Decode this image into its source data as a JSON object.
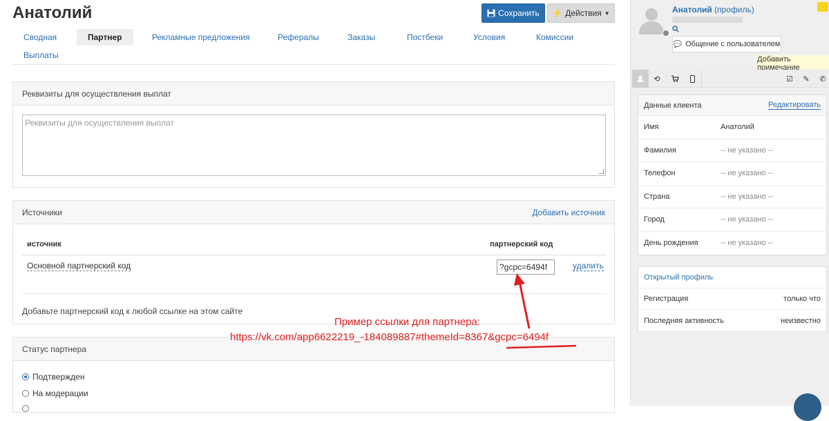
{
  "header": {
    "title": "Анатолий",
    "save_label": "Сохранить",
    "actions_label": "Действия"
  },
  "tabs": [
    {
      "label": "Сводная"
    },
    {
      "label": "Партнер"
    },
    {
      "label": "Рекламные предложения"
    },
    {
      "label": "Рефералы"
    },
    {
      "label": "Заказы"
    },
    {
      "label": "Постбеки"
    },
    {
      "label": "Условия"
    },
    {
      "label": "Комиссии"
    },
    {
      "label": "Выплаты"
    }
  ],
  "requisites": {
    "title": "Реквизиты для осуществления выплат",
    "placeholder": "Реквизиты для осуществления выплат"
  },
  "sources": {
    "title": "Источники",
    "add_label": "Добавить источник",
    "col_source": "источник",
    "col_code": "партнерский код",
    "rows": [
      {
        "name": "Основной партнерский код",
        "code": "?gcpc=6494f",
        "delete_label": "удалить"
      }
    ],
    "hint": "Добавьте партнерский код к любой ссылке на этом сайте"
  },
  "partner_status": {
    "title": "Статус партнера",
    "options": [
      {
        "label": "Подтвержден",
        "selected": true
      },
      {
        "label": "На модерации",
        "selected": false
      }
    ]
  },
  "annotation": {
    "line1": "Пример ссылки для партнера:",
    "line2": "https://vk.com/app6622219_-184089887#themeId=8367&gcpc=6494f",
    "color": "#e02020"
  },
  "sidebar": {
    "user_name": "Анатолий",
    "profile_label": "(профиль)",
    "chat_label": "Общение с пользователем",
    "add_note_label": "Добавить примечание",
    "client_card": {
      "title": "Данные клиента",
      "edit_label": "Редактировать",
      "rows": [
        {
          "label": "Имя",
          "value": "Анатолий"
        },
        {
          "label": "Фамилия",
          "value": "-- не указано --"
        },
        {
          "label": "Телефон",
          "value": "-- не указано --"
        },
        {
          "label": "Страна",
          "value": "-- не указано --"
        },
        {
          "label": "Город",
          "value": "-- не указано --"
        },
        {
          "label": "День рождения",
          "value": "-- не указано --"
        }
      ]
    },
    "profile_card": {
      "open_profile": "Открытый профиль",
      "rows": [
        {
          "label": "Регистрация",
          "value": "только что"
        },
        {
          "label": "Последняя активность",
          "value": "неизвестно"
        }
      ]
    }
  },
  "colors": {
    "accent": "#2a6fb0",
    "save_button": "#2a6fb0"
  }
}
